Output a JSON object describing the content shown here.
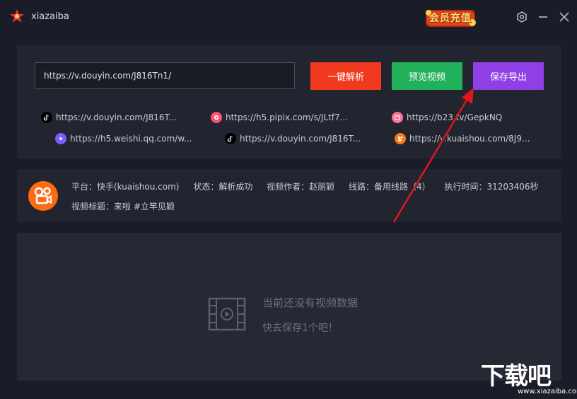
{
  "window": {
    "title": "xiazaiba",
    "vip_badge": "会员充值"
  },
  "input": {
    "value": "https://v.douyin.com/J816Tn1/"
  },
  "buttons": {
    "parse": "一键解析",
    "preview": "预览视频",
    "export": "保存导出"
  },
  "examples": [
    {
      "platform": "douyin",
      "text": "https://v.douyin.com/J816T...",
      "color": "#000000"
    },
    {
      "platform": "pipix",
      "text": "https://h5.pipix.com/s/JLtf7...",
      "color": "#ff4d6d"
    },
    {
      "platform": "bilibili",
      "text": "https://b23.tv/GepkNQ",
      "color": "#fb7299"
    },
    {
      "platform": "weishi",
      "text": "https://h5.weishi.qq.com/w...",
      "color": "#7b5cff"
    },
    {
      "platform": "douyin",
      "text": "https://v.douyin.com/J816T...",
      "color": "#000000"
    },
    {
      "platform": "kuaishou",
      "text": "https://v.kuaishou.com/8J9...",
      "color": "#ff7a16"
    }
  ],
  "info": {
    "platform": "平台：快手(kuaishou.com)",
    "status": "状态：解析成功",
    "author": "视频作者：赵丽颖",
    "route": "线路：备用线路（4）",
    "exec_time": "执行时间：31203406秒",
    "video_title": "视频标题：来啦 #立竿见颖"
  },
  "empty_state": {
    "line1": "当前还没有视频数据",
    "line2": "快去保存1个吧！"
  },
  "watermark": {
    "title": "下载吧",
    "url": "www.xiazaiba.com"
  },
  "colors": {
    "parse": "#f0391f",
    "preview": "#21b15a",
    "export": "#8e3fe6",
    "arrow": "#e2171c",
    "kuaishou": "#ff6a13"
  }
}
